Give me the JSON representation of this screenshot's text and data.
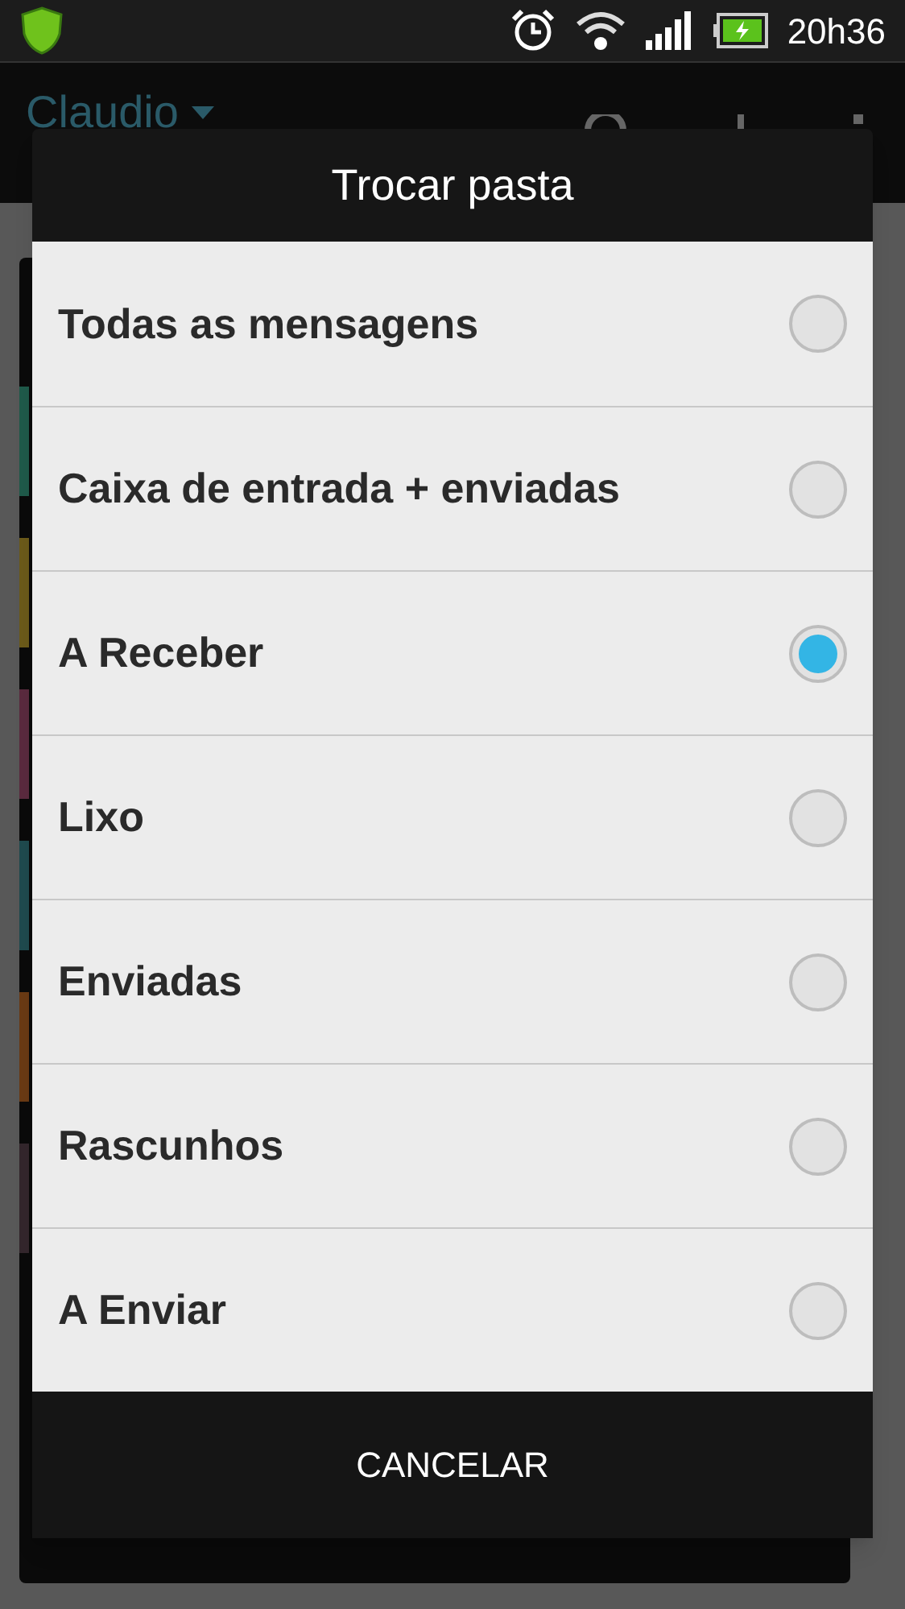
{
  "status_bar": {
    "time": "20h36"
  },
  "app_bar": {
    "account": "Claudio"
  },
  "background_list": {
    "strips": [
      {
        "color": "#1f5a4a"
      },
      {
        "color": "#6b5a1a"
      },
      {
        "color": "#5a2a3e"
      },
      {
        "color": "#1f4a4e"
      },
      {
        "color": "#6a3a14"
      },
      {
        "color": "#33262c"
      }
    ]
  },
  "dialog": {
    "title": "Trocar pasta",
    "options": [
      {
        "label": "Todas as mensagens",
        "selected": false
      },
      {
        "label": "Caixa de entrada + enviadas",
        "selected": false
      },
      {
        "label": "A Receber",
        "selected": true
      },
      {
        "label": "Lixo",
        "selected": false
      },
      {
        "label": "Enviadas",
        "selected": false
      },
      {
        "label": "Rascunhos",
        "selected": false
      },
      {
        "label": "A Enviar",
        "selected": false
      }
    ],
    "cancel": "CANCELAR"
  }
}
